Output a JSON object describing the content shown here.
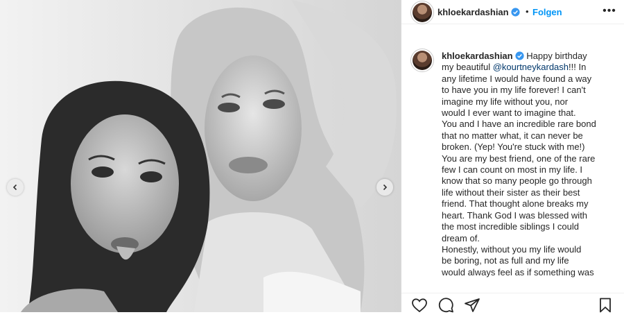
{
  "post": {
    "username": "khloekardashian",
    "separator": "•",
    "follow_label": "Folgen",
    "more_label": "•••",
    "caption_lines": [
      "Happy birthday",
      "my beautiful ",
      "!!! In",
      "any lifetime I would have found a way",
      "to have you in my life forever! I can't",
      "imagine my life without you, nor",
      "would I ever want to imagine that.",
      "You and I have an incredible rare bond",
      "that no matter what, it can never be",
      "broken. (Yep! You're stuck with me!)",
      "You are my best friend, one of the rare",
      "few I can count on most in my life. I",
      "know that so many people go through",
      "life without their sister as their best",
      "friend. That thought alone breaks my",
      "heart. Thank God I was blessed with",
      "the most incredible siblings I could",
      "dream of.",
      "Honestly, without you my life would",
      "be boring, not as full and my life",
      "would always feel as if something was"
    ],
    "mention": "@kourtneykardash"
  },
  "icons": {
    "prev": "chevron-left-icon",
    "next": "chevron-right-icon",
    "verified": "verified-badge-icon",
    "like": "heart-icon",
    "comment": "comment-icon",
    "share": "paper-plane-icon",
    "save": "bookmark-icon"
  },
  "colors": {
    "link_blue": "#0095f6",
    "verified_blue": "#3897f0",
    "text": "#262626"
  }
}
